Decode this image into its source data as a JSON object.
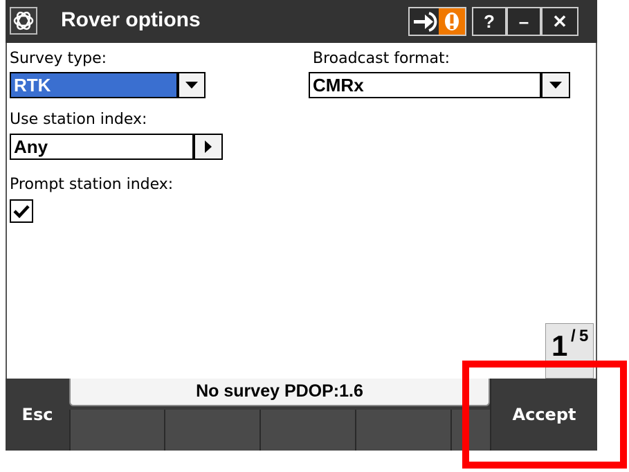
{
  "window": {
    "title": "Rover options",
    "icons": {
      "app": "trimble-logo-icon",
      "connect": "arrow-right-icon",
      "alert": "exclamation-icon"
    },
    "help_label": "?",
    "minimize_label": "–",
    "close_label": "✕"
  },
  "form": {
    "survey_type": {
      "label": "Survey type:",
      "value": "RTK"
    },
    "broadcast_format": {
      "label": "Broadcast format:",
      "value": "CMRx"
    },
    "station_index": {
      "label": "Use station index:",
      "value": "Any"
    },
    "prompt_station_index": {
      "label": "Prompt station index:",
      "checked": true
    }
  },
  "pager": {
    "current": "1",
    "total": "5"
  },
  "statusbar": {
    "text": "No survey  PDOP:1.6"
  },
  "softkeys": {
    "esc": "Esc",
    "accept": "Accept"
  },
  "colors": {
    "selection": "#3a6fd0",
    "titlebar": "#333333",
    "alert": "#f07800",
    "highlight": "#ff0000"
  }
}
